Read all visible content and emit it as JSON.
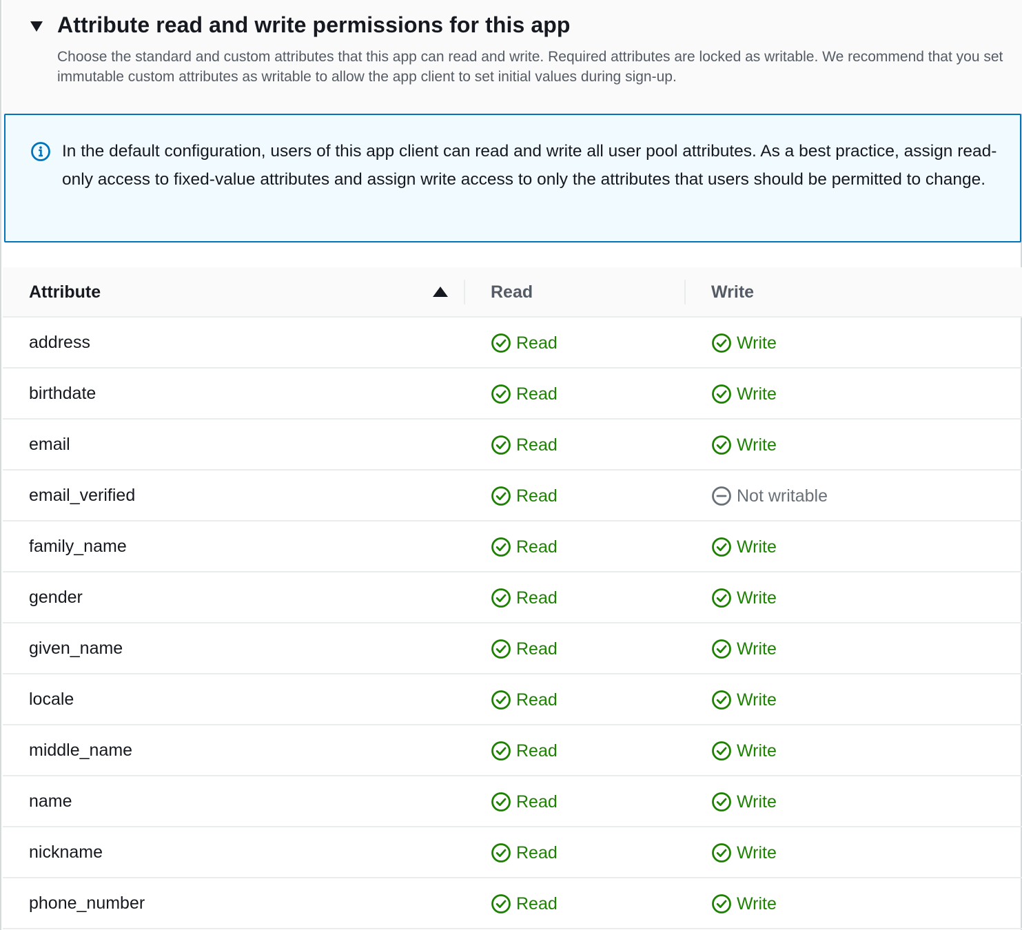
{
  "section": {
    "title": "Attribute read and write permissions for this app",
    "description": "Choose the standard and custom attributes that this app can read and write. Required attributes are locked as writable. We recommend that you set immutable custom attributes as writable to allow the app client to set initial values during sign-up."
  },
  "info_alert": {
    "icon": "info-icon",
    "text": "In the default configuration, users of this app client can read and write all user pool attributes. As a best practice, assign read-only access to fixed-value attributes and assign write access to only the attributes that users should be permitted to change."
  },
  "table": {
    "columns": [
      "Attribute",
      "Read",
      "Write"
    ],
    "sort": {
      "column": "Attribute",
      "direction": "ascending"
    },
    "rows": [
      {
        "attribute": "address",
        "read": "Read",
        "write": "Write"
      },
      {
        "attribute": "birthdate",
        "read": "Read",
        "write": "Write"
      },
      {
        "attribute": "email",
        "read": "Read",
        "write": "Write"
      },
      {
        "attribute": "email_verified",
        "read": "Read",
        "write": "Not writable"
      },
      {
        "attribute": "family_name",
        "read": "Read",
        "write": "Write"
      },
      {
        "attribute": "gender",
        "read": "Read",
        "write": "Write"
      },
      {
        "attribute": "given_name",
        "read": "Read",
        "write": "Write"
      },
      {
        "attribute": "locale",
        "read": "Read",
        "write": "Write"
      },
      {
        "attribute": "middle_name",
        "read": "Read",
        "write": "Write"
      },
      {
        "attribute": "name",
        "read": "Read",
        "write": "Write"
      },
      {
        "attribute": "nickname",
        "read": "Read",
        "write": "Write"
      },
      {
        "attribute": "phone_number",
        "read": "Read",
        "write": "Write"
      }
    ]
  },
  "colors": {
    "success": "#1d8102",
    "disabled": "#687078",
    "info_border": "#0073bb",
    "info_bg": "#f1faff"
  }
}
